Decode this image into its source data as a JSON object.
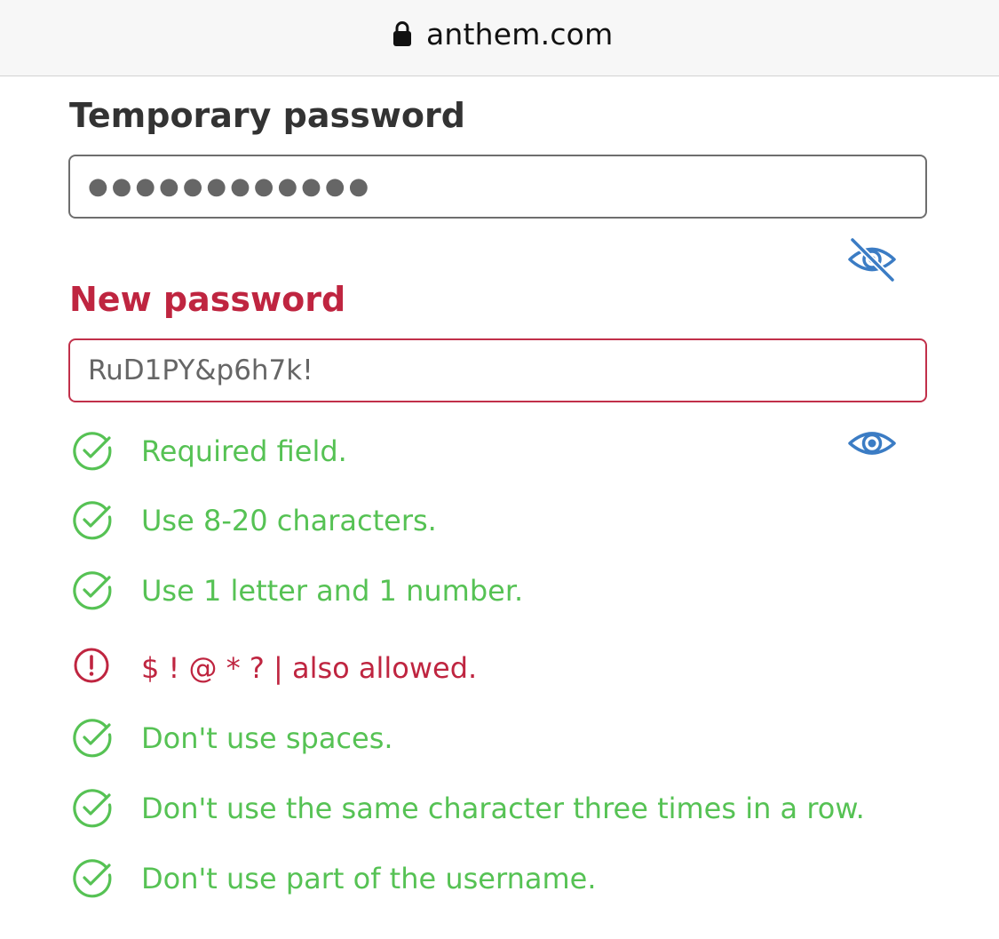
{
  "browser": {
    "url": "anthem.com",
    "lock_icon": "lock-icon"
  },
  "temporary_password": {
    "label": "Temporary password",
    "value": "●●●●●●●●●●●●",
    "toggle_icon": "eye-slash-icon"
  },
  "new_password": {
    "label": "New password",
    "value": "RuD1PY&p6h7k!",
    "toggle_icon": "eye-icon"
  },
  "rules": [
    {
      "text": "Required field.",
      "status": "met"
    },
    {
      "text": "Use 8-20 characters.",
      "status": "met"
    },
    {
      "text": "Use 1 letter and 1 number.",
      "status": "met"
    },
    {
      "text": "$ ! @ * ? | also allowed.",
      "status": "warning"
    },
    {
      "text": "Don't use spaces.",
      "status": "met"
    },
    {
      "text": "Don't use the same character three times in a row.",
      "status": "met"
    },
    {
      "text": "Don't use part of the username.",
      "status": "met"
    }
  ],
  "colors": {
    "success": "#56c254",
    "error": "#bf2540",
    "link_blue": "#3b7cc4",
    "label_dark": "#333333"
  }
}
